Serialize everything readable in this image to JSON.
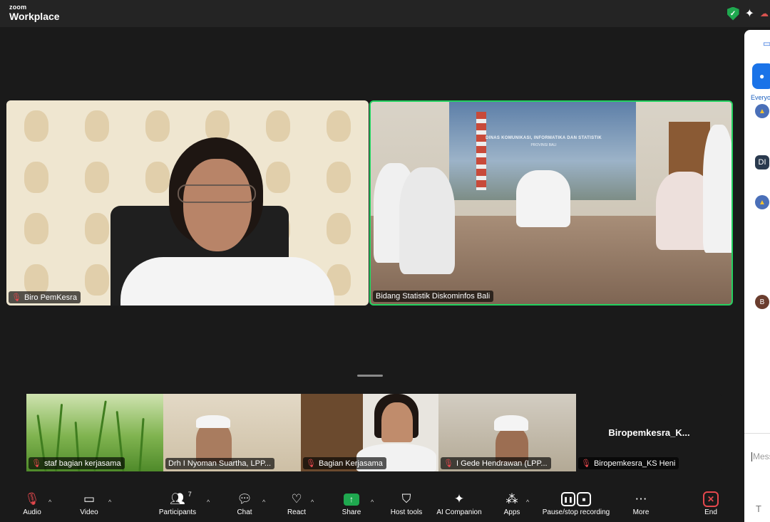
{
  "app": {
    "brand_small": "zoom",
    "brand_large": "Workplace"
  },
  "colors": {
    "active_speaker_border": "#23d160",
    "mute_icon": "#e5484d",
    "shield_green": "#1fa84f",
    "share_green": "#1fa84f",
    "end_red": "#e5484d",
    "panel_accent": "#1a73e8"
  },
  "titlebar": {
    "icons": [
      "shield-check-icon",
      "sparkle-icon",
      "cloud-icon"
    ]
  },
  "main_tiles": [
    {
      "name": "Biro PemKesra",
      "muted": true,
      "active_speaker": false
    },
    {
      "name": "Bidang Statistik Diskominfos Bali",
      "muted": false,
      "active_speaker": true
    }
  ],
  "banner": {
    "title": "DINAS KOMUNIKASI, INFORMATIKA DAN STATISTIK",
    "subtitle": "PROVINSI BALI"
  },
  "gallery": [
    {
      "name": "staf bagian kerjasama",
      "muted": true
    },
    {
      "name": "Drh I Nyoman Suartha, LPP...",
      "muted": false
    },
    {
      "name": "Bagian Kerjasama",
      "muted": true
    },
    {
      "name": "I Gede Hendrawan (LPP...",
      "muted": true
    },
    {
      "name": "Biropemkesra_KS Heni",
      "muted": true,
      "video_off_label": "Biropemkesra_K..."
    }
  ],
  "side_panel": {
    "recipient_label": "Everyo",
    "avatars": [
      "DI",
      "B"
    ],
    "message_placeholder": "Mess",
    "format_icon": "T"
  },
  "toolbar": {
    "audio": "Audio",
    "video": "Video",
    "participants": "Participants",
    "participants_count": "7",
    "chat": "Chat",
    "react": "React",
    "share": "Share",
    "host_tools": "Host tools",
    "ai_companion": "AI Companion",
    "apps": "Apps",
    "recording": "Pause/stop recording",
    "more": "More",
    "end": "End"
  }
}
